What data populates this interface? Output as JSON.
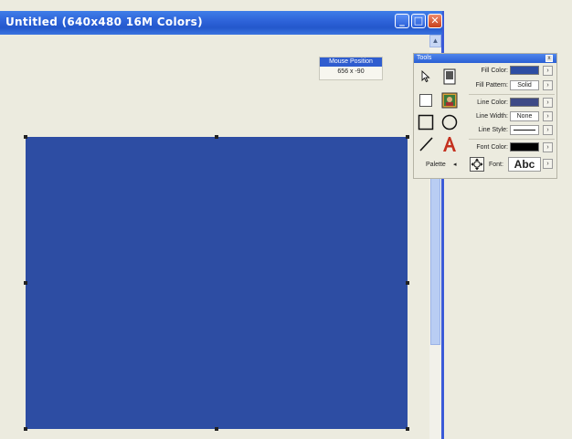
{
  "window": {
    "title": "Untitled (640x480 16M Colors)"
  },
  "titlebar_buttons": {
    "minimize": "_",
    "maximize": "□",
    "close": "✕"
  },
  "mouse_position": {
    "title": "Mouse Position",
    "value": "656 x -90"
  },
  "tools": {
    "title": "Tools",
    "close": "x",
    "palette_label": "Palette",
    "palette_arrow": "◂",
    "fill_color_label": "Fill Color:",
    "fill_color": "#2d4da3",
    "fill_pattern_label": "Fill Pattern:",
    "fill_pattern_value": "Solid",
    "line_color_label": "Line Color:",
    "line_color": "#3e4a86",
    "line_width_label": "Line Width:",
    "line_width_value": "None",
    "line_style_label": "Line Style:",
    "font_color_label": "Font Color:",
    "font_color": "#000000",
    "font_label": "Font:",
    "font_sample": "Abc",
    "arrow_glyph": "›"
  },
  "colors": {
    "titlebar": "#2d62d8",
    "canvas_fill": "#2d4da3",
    "background": "#ecebdf"
  },
  "icons": [
    "pointer-icon",
    "page-icon",
    "select-rect-icon",
    "picture-icon",
    "rectangle-tool-icon",
    "ellipse-tool-icon",
    "line-tool-icon",
    "text-tool-icon",
    "move-icon"
  ]
}
